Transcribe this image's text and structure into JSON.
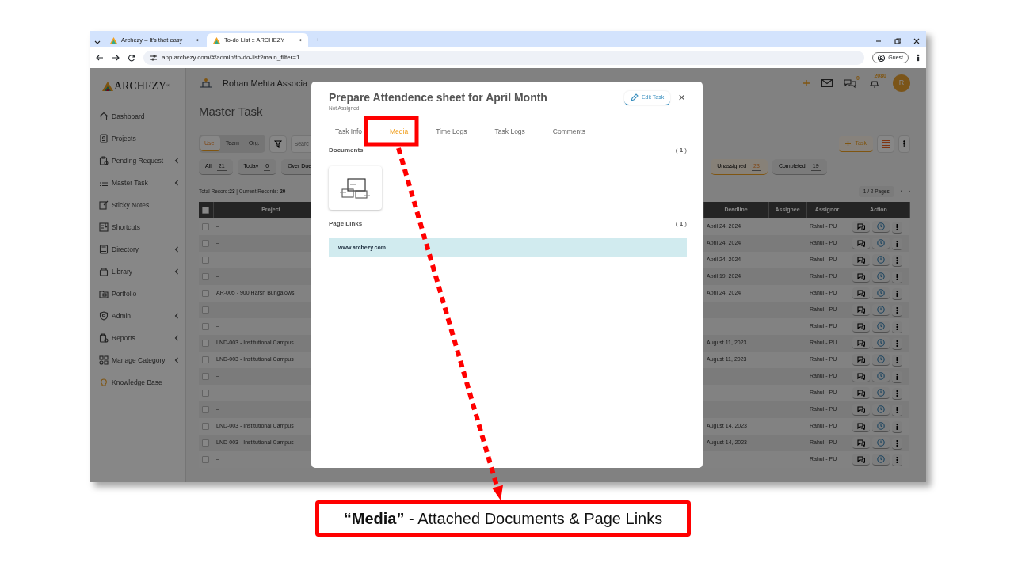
{
  "browser": {
    "tabs": [
      {
        "title": "Archezy – It's that easy",
        "selected": false,
        "close": "×"
      },
      {
        "title": "To-do List :: ARCHEZY",
        "selected": true,
        "close": "×"
      }
    ],
    "new_tab": "+",
    "url": "app.archezy.com/#/admin/to-do-list?main_filter=1",
    "profile": "Guest"
  },
  "app": {
    "logo": "ARCHEZY$^{®}$",
    "sidebar": [
      {
        "label": "Dashboard",
        "submenu": false
      },
      {
        "label": "Projects",
        "submenu": false
      },
      {
        "label": "Pending Request",
        "submenu": true
      },
      {
        "label": "Master Task",
        "submenu": true
      },
      {
        "label": "Sticky Notes",
        "submenu": false
      },
      {
        "label": "Shortcuts",
        "submenu": false
      },
      {
        "label": "Directory",
        "submenu": true
      },
      {
        "label": "Library",
        "submenu": true
      },
      {
        "label": "Portfolio",
        "submenu": false
      },
      {
        "label": "Admin",
        "submenu": true
      },
      {
        "label": "Reports",
        "submenu": true
      },
      {
        "label": "Manage Category",
        "submenu": true
      },
      {
        "label": "Knowledge Base",
        "submenu": false
      }
    ],
    "header": {
      "company": "Rohan Mehta Associa",
      "chat_count": "0",
      "notification_count": "2080",
      "avatar": "R"
    },
    "page_title": "Master Task",
    "scope_toggle": [
      {
        "label": "User",
        "selected": true
      },
      {
        "label": "Team",
        "selected": false
      },
      {
        "label": "Org.",
        "selected": false
      }
    ],
    "search": {
      "placeholder": "Searc"
    },
    "add_button": "Task",
    "filters": [
      {
        "label": "All",
        "count": "21",
        "selected": false
      },
      {
        "label": "Today",
        "count": "0",
        "selected": false
      },
      {
        "label": "Over Due",
        "selected": false
      },
      {
        "label": "Unassigned",
        "count": "23",
        "selected": true
      },
      {
        "label": "Completed",
        "count": "19",
        "selected": false
      }
    ],
    "records": "Total Record:**23** | Current Records: **20**",
    "pages": "1 / 2 Pages",
    "prev": "‹",
    "next": "›",
    "table": {
      "select_all_checked": false,
      "columns": [
        "Project",
        "Deadline",
        "Assignee",
        "Assignor",
        "Action"
      ],
      "rows": [
        {
          "checked": false,
          "project": "–",
          "deadline": "April 24, 2024",
          "assignor": "Rahul - PU"
        },
        {
          "checked": false,
          "project": "–",
          "deadline": "April 24, 2024",
          "assignor": "Rahul - PU"
        },
        {
          "checked": false,
          "project": "–",
          "deadline": "April 24, 2024",
          "assignor": "Rahul - PU"
        },
        {
          "checked": false,
          "project": "–",
          "deadline": "April 19, 2024",
          "assignor": "Rahul - PU"
        },
        {
          "checked": false,
          "project": "AR-005 - 900 Harsh Bungalows",
          "deadline": "April 24, 2024",
          "assignor": "Rahul - PU"
        },
        {
          "checked": false,
          "project": "–",
          "assignor": "Rahul - PU"
        },
        {
          "checked": false,
          "project": "–",
          "assignor": "Rahul - PU"
        },
        {
          "checked": false,
          "project": "LND-003 - Institutional Campus",
          "deadline": "August 11, 2023",
          "assignor": "Rahul - PU"
        },
        {
          "checked": false,
          "project": "LND-003 - Institutional Campus",
          "deadline": "August 11, 2023",
          "assignor": "Rahul - PU"
        },
        {
          "checked": false,
          "project": "–",
          "assignor": "Rahul - PU"
        },
        {
          "checked": false,
          "project": "–",
          "assignor": "Rahul - PU"
        },
        {
          "checked": false,
          "project": "–",
          "assignor": "Rahul - PU"
        },
        {
          "checked": false,
          "project": "LND-003 - Institutional Campus",
          "deadline": "August 14, 2023",
          "assignor": "Rahul - PU"
        },
        {
          "checked": false,
          "project": "LND-003 - Institutional Campus",
          "deadline": "August 14, 2023",
          "assignor": "Rahul - PU"
        },
        {
          "checked": false,
          "project": "–",
          "assignor": "Rahul - PU"
        }
      ]
    }
  },
  "modal": {
    "title": "Prepare Attendence sheet for April Month",
    "subtitle": "Not Assigned",
    "edit_button": "Edit Task",
    "close": "×",
    "tabs": [
      {
        "label": "Task Info",
        "selected": false
      },
      {
        "label": "Media",
        "selected": true
      },
      {
        "label": "Time Logs",
        "selected": false
      },
      {
        "label": "Task Logs",
        "selected": false
      },
      {
        "label": "Comments",
        "selected": false
      }
    ],
    "documents": {
      "heading": "Documents",
      "count": "( **1** )"
    },
    "page_links": {
      "heading": "Page Links",
      "count": "( **1** )",
      "links": [
        "www.archezy.com"
      ]
    }
  },
  "annotation": {
    "caption": "**“Media”** - Attached Documents & Page Links"
  }
}
